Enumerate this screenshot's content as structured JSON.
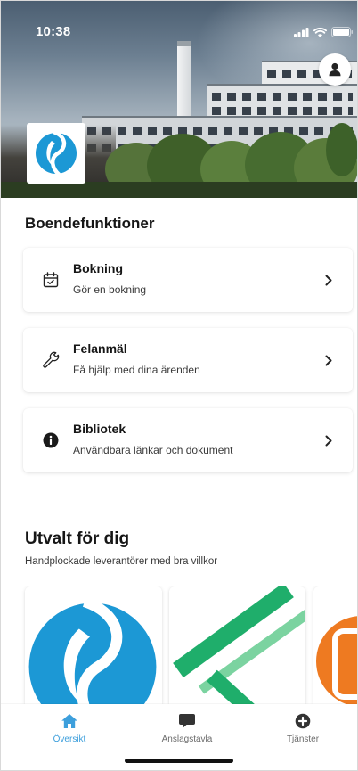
{
  "status_bar": {
    "time": "10:38",
    "icons": [
      "signal-icon",
      "wifi-icon",
      "battery-icon"
    ]
  },
  "hero": {
    "logo": "brand-logo",
    "profile_button_icon": "person-icon"
  },
  "functions": {
    "title": "Boendefunktioner",
    "chevron_icon": "chevron-right-icon",
    "items": [
      {
        "icon": "calendar-icon",
        "title": "Bokning",
        "subtitle": "Gör en bokning"
      },
      {
        "icon": "wrench-icon",
        "title": "Felanmäl",
        "subtitle": "Få hjälp med dina ärenden"
      },
      {
        "icon": "info-icon",
        "title": "Bibliotek",
        "subtitle": "Användbara länkar och dokument"
      }
    ]
  },
  "featured": {
    "title": "Utvalt för dig",
    "subtitle": "Handplockade leverantörer med bra villkor",
    "cards": [
      {
        "logo": "blue-s-logo"
      },
      {
        "logo": "green-stripes-logo"
      },
      {
        "logo": "orange-device-logo"
      }
    ]
  },
  "tab_bar": {
    "tabs": [
      {
        "label": "Översikt",
        "icon": "home-icon",
        "active": true
      },
      {
        "label": "Anslagstavla",
        "icon": "chat-icon",
        "active": false
      },
      {
        "label": "Tjänster",
        "icon": "plus-circle-icon",
        "active": false
      }
    ]
  },
  "colors": {
    "accent": "#3d9fdc",
    "brand_blue": "#1c98d5",
    "partner_green": "#1fae6b",
    "partner_green_light": "#7bd3a0",
    "partner_orange": "#ee7a21",
    "text_primary": "#161616",
    "text_secondary": "#3a3a3a",
    "tab_inactive": "#6b6b6b"
  }
}
